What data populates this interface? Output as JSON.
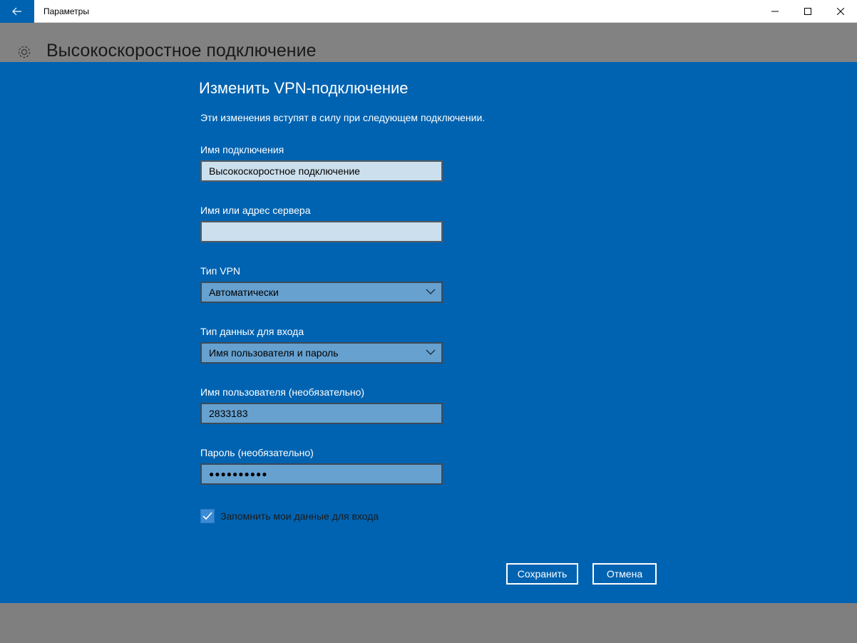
{
  "window": {
    "title": "Параметры",
    "controls": {
      "minimize": "minimize-icon",
      "maximize": "maximize-icon",
      "close": "close-icon"
    }
  },
  "background": {
    "page_title": "Высокоскоростное подключение",
    "icon": "gear-icon"
  },
  "dialog": {
    "title": "Изменить VPN-подключение",
    "subtitle": "Эти изменения вступят в силу при следующем подключении.",
    "fields": {
      "connection_name": {
        "label": "Имя подключения",
        "value": "Высокоскоростное подключение"
      },
      "server": {
        "label": "Имя или адрес сервера",
        "value": ""
      },
      "vpn_type": {
        "label": "Тип VPN",
        "selected": "Автоматически"
      },
      "signin_type": {
        "label": "Тип данных для входа",
        "selected": "Имя пользователя и пароль"
      },
      "username": {
        "label": "Имя пользователя (необязательно)",
        "value": "2833183"
      },
      "password": {
        "label": "Пароль (необязательно)",
        "value": "●●●●●●●●●●"
      }
    },
    "remember": {
      "label": "Запомнить мои данные для входа",
      "checked": true
    },
    "buttons": {
      "save": "Сохранить",
      "cancel": "Отмена"
    }
  },
  "colors": {
    "accent": "#0063b1",
    "dim_overlay": "#7f7f7f",
    "field_light": "#ccdfed",
    "field_medium": "#66a1d0"
  }
}
